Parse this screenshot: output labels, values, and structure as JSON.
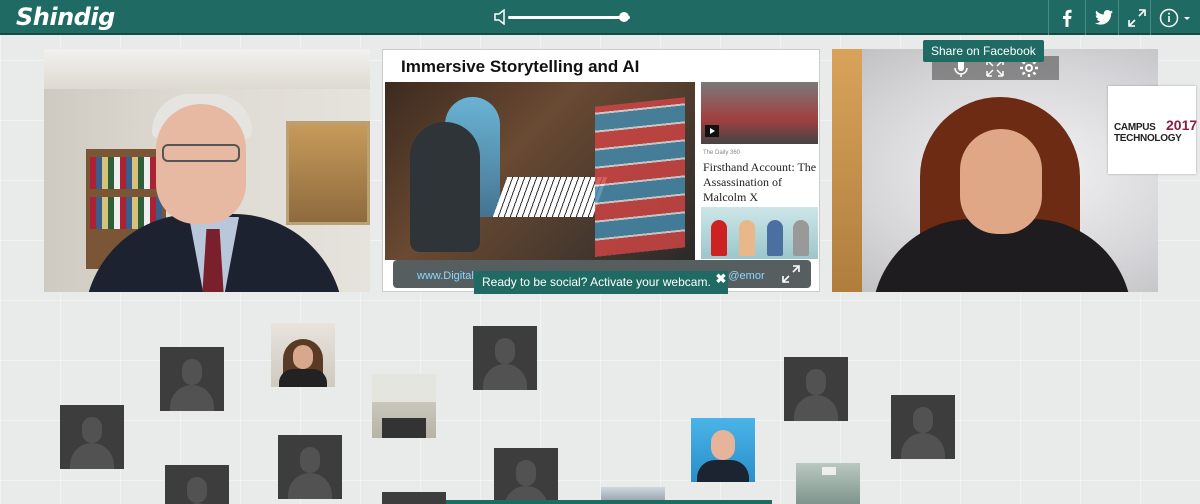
{
  "app": {
    "logo": "Shindig"
  },
  "toolbar": {
    "volume_level": 0.95,
    "buttons": [
      {
        "name": "facebook-icon"
      },
      {
        "name": "twitter-icon"
      },
      {
        "name": "fullscreen-icon"
      },
      {
        "name": "info-icon"
      }
    ]
  },
  "slide": {
    "title": "Immersive Storytelling and AI",
    "article_source": "The Daily 360",
    "article_title": "Firsthand Account: The Assassination of Malcolm X",
    "footer_link_1": "www.DigitalD",
    "footer_link_2": "& @emor"
  },
  "tooltips": {
    "share_facebook": "Share on Facebook"
  },
  "banner": {
    "webcam": "Ready to be social? Activate your webcam.",
    "close": "✖"
  },
  "logo_overlay": {
    "line1": "CAMPUS",
    "year": "2017",
    "line2": "TECHNOLOGY"
  },
  "colors": {
    "brand": "#1f6b63",
    "background": "#e9ebeb",
    "placeholder": "#3d3d3d"
  }
}
